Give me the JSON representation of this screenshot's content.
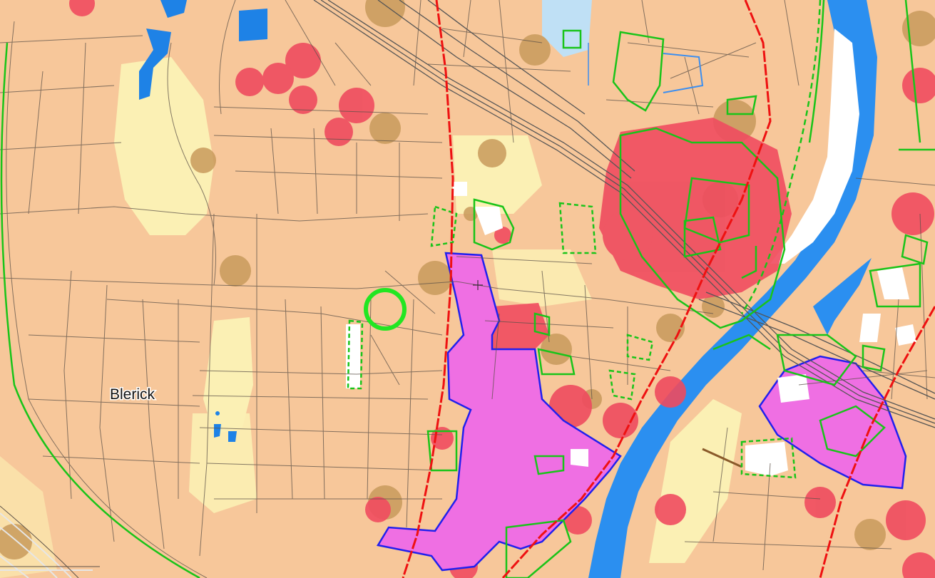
{
  "map": {
    "labels": {
      "blerick": "Blerick"
    },
    "colors": {
      "base": "#f7c79a",
      "road_lines": "#5c5148",
      "river": "#2b8ff0",
      "red_zone": "#ef4b5f",
      "magenta_zone": "#ef6fe3",
      "yellow_zone": "#fbf0b4",
      "brown_zone": "#c89a5c",
      "green_outline": "#19c419",
      "blue_outline": "#2020ee",
      "red_route": "#ee1111",
      "white_block": "#ffffff",
      "light_blue_zone": "#bfe0f5",
      "water_pond": "#1e82e6"
    },
    "marker": {
      "type": "circle",
      "color": "#22e622"
    }
  }
}
